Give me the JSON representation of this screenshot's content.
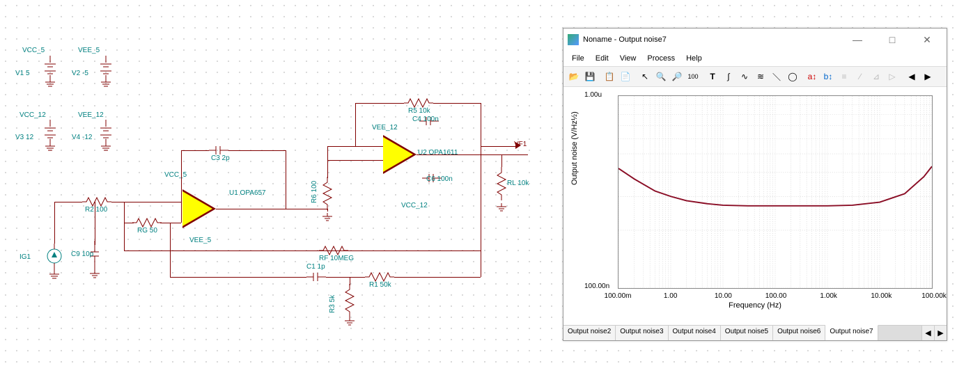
{
  "schematic": {
    "power": {
      "vcc5_label": "VCC_5",
      "vee5_label": "VEE_5",
      "vcc12_label": "VCC_12",
      "vee12_label": "VEE_12",
      "v1": "V1 5",
      "v2": "V2 -5",
      "v3": "V3 12",
      "v4": "V4 -12"
    },
    "components": {
      "c3": "C3 2p",
      "c4": "C4 100n",
      "c6": "C6 100n",
      "c1": "C1 1p",
      "c9": "C9 10p",
      "r5": "R5 10k",
      "r6": "R6 100",
      "r2": "R2 100",
      "rg": "RG 50",
      "rf": "RF 10MEG",
      "r1": "R1 50k",
      "r3": "R3 5k",
      "rl": "RL 10k",
      "u1": "U1 OPA657",
      "u2": "U2 OPA1611",
      "u1_vcc": "VCC_5",
      "u1_vee": "VEE_5",
      "u2_vcc": "VCC_12",
      "u2_vee": "VEE_12",
      "ig1": "IG1",
      "vf1": "VF1"
    }
  },
  "window": {
    "title": "Noname - Output noise7",
    "menu": {
      "file": "File",
      "edit": "Edit",
      "view": "View",
      "process": "Process",
      "help": "Help"
    },
    "plot": {
      "y_label": "Output noise (V/Hz½)",
      "x_label": "Frequency (Hz)",
      "y_ticks": [
        "1.00u",
        "100.00n"
      ],
      "x_ticks": [
        "100.00m",
        "1.00",
        "10.00",
        "100.00",
        "1.00k",
        "10.00k",
        "100.00k"
      ]
    },
    "tabs": [
      "Output noise2",
      "Output noise3",
      "Output noise4",
      "Output noise5",
      "Output noise6",
      "Output noise7"
    ],
    "active_tab": 5
  },
  "chart_data": {
    "type": "line",
    "title": "Output noise7",
    "x_scale": "log",
    "y_scale": "log",
    "xlabel": "Frequency (Hz)",
    "ylabel": "Output noise (V/Hz½)",
    "xlim": [
      0.1,
      100000
    ],
    "ylim": [
      1e-07,
      1e-06
    ],
    "series": [
      {
        "name": "Output noise",
        "color": "#8a0d25",
        "x": [
          0.1,
          0.2,
          0.5,
          1,
          2,
          5,
          10,
          30,
          100,
          300,
          1000,
          3000,
          10000,
          30000,
          70000,
          100000
        ],
        "y": [
          4.2e-07,
          3.7e-07,
          3.2e-07,
          3e-07,
          2.85e-07,
          2.75e-07,
          2.7e-07,
          2.68e-07,
          2.68e-07,
          2.68e-07,
          2.68e-07,
          2.7e-07,
          2.8e-07,
          3.1e-07,
          3.8e-07,
          4.3e-07
        ]
      }
    ]
  }
}
